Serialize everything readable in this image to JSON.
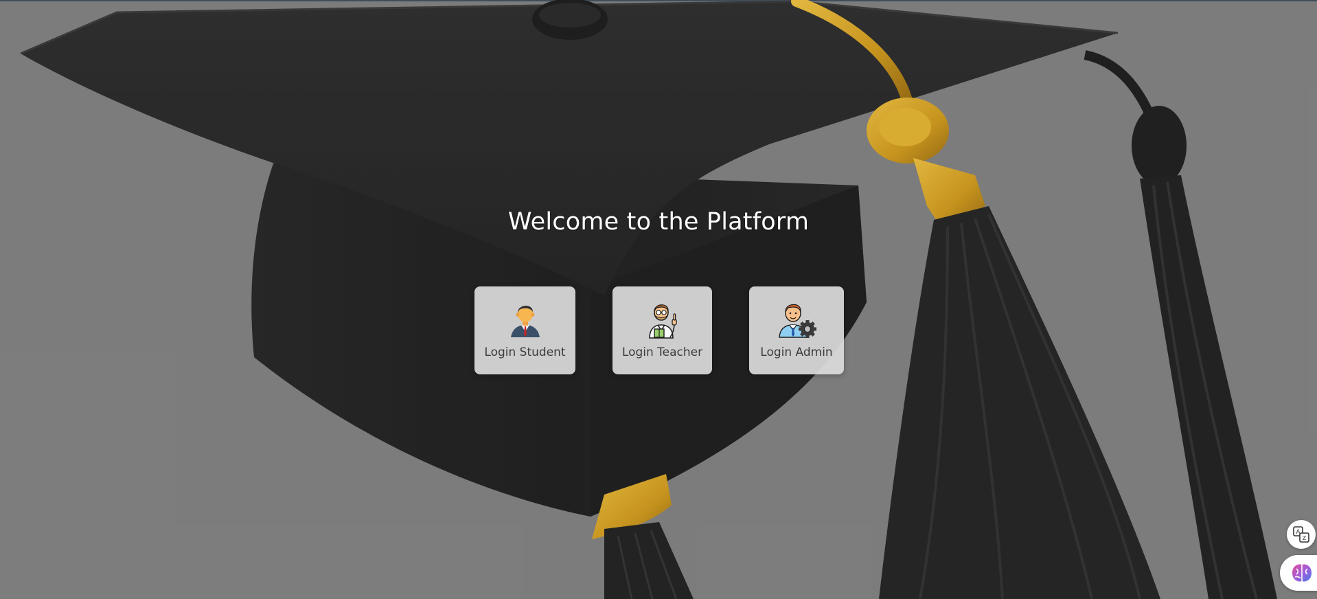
{
  "header": {
    "title": "Welcome to the Platform"
  },
  "login_options": [
    {
      "label": "Login Student",
      "icon": "student-icon"
    },
    {
      "label": "Login Teacher",
      "icon": "teacher-icon"
    },
    {
      "label": "Login Admin",
      "icon": "admin-icon"
    }
  ],
  "background": {
    "image": "graduation-cap-icon"
  },
  "floating_actions": [
    {
      "icon": "translate-icon"
    },
    {
      "icon": "brain-icon"
    }
  ],
  "colors": {
    "background": "#7f7f7f",
    "card": "#dadada",
    "title_text": "#ffffff",
    "label_text": "#3b3b3b",
    "cap_gold": "#d9a21a"
  }
}
